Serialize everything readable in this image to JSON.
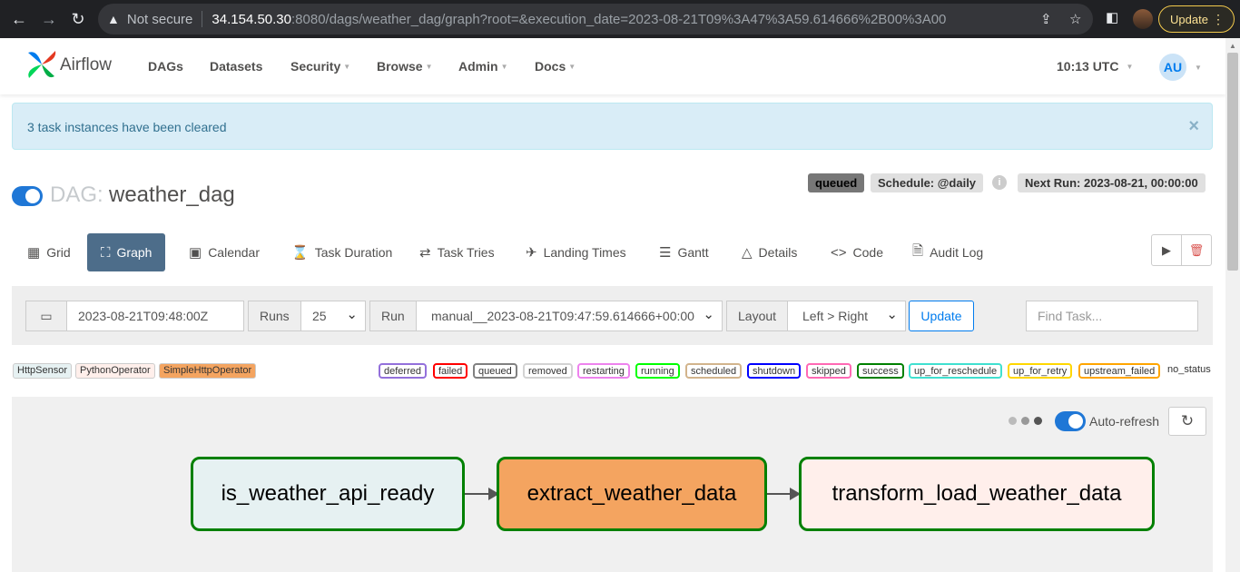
{
  "browser": {
    "not_secure": "Not secure",
    "url_host": "34.154.50.30",
    "url_rest": ":8080/dags/weather_dag/graph?root=&execution_date=2023-08-21T09%3A47%3A59.614666%2B00%3A00",
    "update_label": "Update"
  },
  "navbar": {
    "brand": "Airflow",
    "items": [
      "DAGs",
      "Datasets",
      "Security",
      "Browse",
      "Admin",
      "Docs"
    ],
    "time": "10:13 UTC",
    "user_initials": "AU"
  },
  "alert": {
    "message": "3 task instances have been cleared",
    "close": "×"
  },
  "dag": {
    "prefix": "DAG:",
    "name": "weather_dag",
    "state_badge": "queued",
    "schedule": "Schedule: @daily",
    "next_run": "Next Run: 2023-08-21, 00:00:00"
  },
  "tabs": [
    "Grid",
    "Graph",
    "Calendar",
    "Task Duration",
    "Task Tries",
    "Landing Times",
    "Gantt",
    "Details",
    "Code",
    "Audit Log"
  ],
  "filters": {
    "base_date": "2023-08-21T09:48:00Z",
    "runs_label": "Runs",
    "runs_value": "25",
    "run_label": "Run",
    "run_value": "manual__2023-08-21T09:47:59.614666+00:00",
    "layout_label": "Layout",
    "layout_value": "Left > Right",
    "update_label": "Update",
    "find_placeholder": "Find Task..."
  },
  "operators": [
    {
      "name": "HttpSensor",
      "color": "#e6f1f2"
    },
    {
      "name": "PythonOperator",
      "color": "#ffefeb"
    },
    {
      "name": "SimpleHttpOperator",
      "color": "#f4a460"
    }
  ],
  "states": [
    {
      "name": "deferred",
      "color": "#9370db"
    },
    {
      "name": "failed",
      "color": "#ff0000"
    },
    {
      "name": "queued",
      "color": "#808080"
    },
    {
      "name": "removed",
      "color": "#d3d3d3"
    },
    {
      "name": "restarting",
      "color": "#ee82ee"
    },
    {
      "name": "running",
      "color": "#00ff00"
    },
    {
      "name": "scheduled",
      "color": "#d2b48c"
    },
    {
      "name": "shutdown",
      "color": "#0000ff"
    },
    {
      "name": "skipped",
      "color": "#ff69b4"
    },
    {
      "name": "success",
      "color": "#008000"
    },
    {
      "name": "up_for_reschedule",
      "color": "#40e0d0"
    },
    {
      "name": "up_for_retry",
      "color": "#ffd700"
    },
    {
      "name": "upstream_failed",
      "color": "#ffa500"
    },
    {
      "name": "no_status",
      "color": "#ffffff"
    }
  ],
  "graph": {
    "autorefresh_label": "Auto-refresh",
    "tasks": [
      {
        "id": "is_weather_api_ready",
        "fill": "#e6f1f2"
      },
      {
        "id": "extract_weather_data",
        "fill": "#f4a460"
      },
      {
        "id": "transform_load_weather_data",
        "fill": "#ffefeb"
      }
    ]
  }
}
